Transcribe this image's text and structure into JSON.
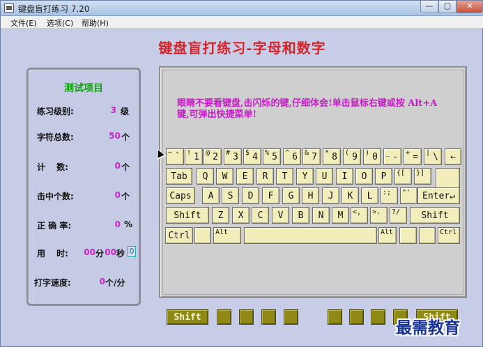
{
  "window": {
    "title": "键盘盲打练习 7.20",
    "min": "—",
    "max": "▢",
    "close": "✕"
  },
  "menu": {
    "file": "文件(E)",
    "options": "选项(C)",
    "help": "帮助(H)"
  },
  "heading": "键盘盲打练习-字母和数字",
  "stats": {
    "title": "测试项目",
    "level_label": "练习级别:",
    "level_value": "3",
    "level_unit": "级",
    "total_label": "字符总数:",
    "total_value": "50",
    "total_unit": "个",
    "count_label": "计　 数:",
    "count_value": "0",
    "count_unit": "个",
    "hits_label": "击中个数:",
    "hits_value": "0",
    "hits_unit": "个",
    "accuracy_label": "正 确 率:",
    "accuracy_value": "0",
    "accuracy_unit": "%",
    "time_label": "用　 时:",
    "time_min": "00",
    "time_min_unit": "分",
    "time_sec": "00",
    "time_sec_unit": "秒",
    "time_box": "0",
    "speed_label": "打字速度:",
    "speed_value": "0",
    "speed_unit": "个/分"
  },
  "instruction": "眼睛不要看键盘,击闪烁的键,仔细体会!单击鼠标右键或按 Alt+A 键,可弹出快捷菜单!",
  "keyboard": {
    "row1": [
      {
        "top": "~",
        "main": "`"
      },
      {
        "top": "!",
        "main": "1"
      },
      {
        "top": "@",
        "main": "2"
      },
      {
        "top": "#",
        "main": "3"
      },
      {
        "top": "$",
        "main": "4"
      },
      {
        "top": "%",
        "main": "5"
      },
      {
        "top": "^",
        "main": "6"
      },
      {
        "top": "&",
        "main": "7"
      },
      {
        "top": "*",
        "main": "8"
      },
      {
        "top": "(",
        "main": "9"
      },
      {
        "top": ")",
        "main": "0"
      },
      {
        "top": "_",
        "main": "-"
      },
      {
        "top": "+",
        "main": "="
      },
      {
        "top": "|",
        "main": "\\"
      },
      {
        "top": "",
        "main": "←"
      }
    ],
    "row2": [
      "Tab",
      "Q",
      "W",
      "E",
      "R",
      "T",
      "Y",
      "U",
      "I",
      "O",
      "P",
      "{[",
      "}]"
    ],
    "row3": [
      "Caps",
      "A",
      "S",
      "D",
      "F",
      "G",
      "H",
      "J",
      "K",
      "L",
      ":;",
      "\"'",
      "Enter↵"
    ],
    "row4": [
      "Shift",
      "Z",
      "X",
      "C",
      "V",
      "B",
      "N",
      "M",
      "<,",
      ">.",
      "?/",
      "Shift"
    ],
    "row5": [
      "Ctrl",
      "",
      "Alt",
      "",
      "Alt",
      "",
      "",
      "Ctrl"
    ]
  },
  "bottom": {
    "shift_left": "Shift",
    "shift_right": "Shift"
  },
  "watermark": "最需教育"
}
